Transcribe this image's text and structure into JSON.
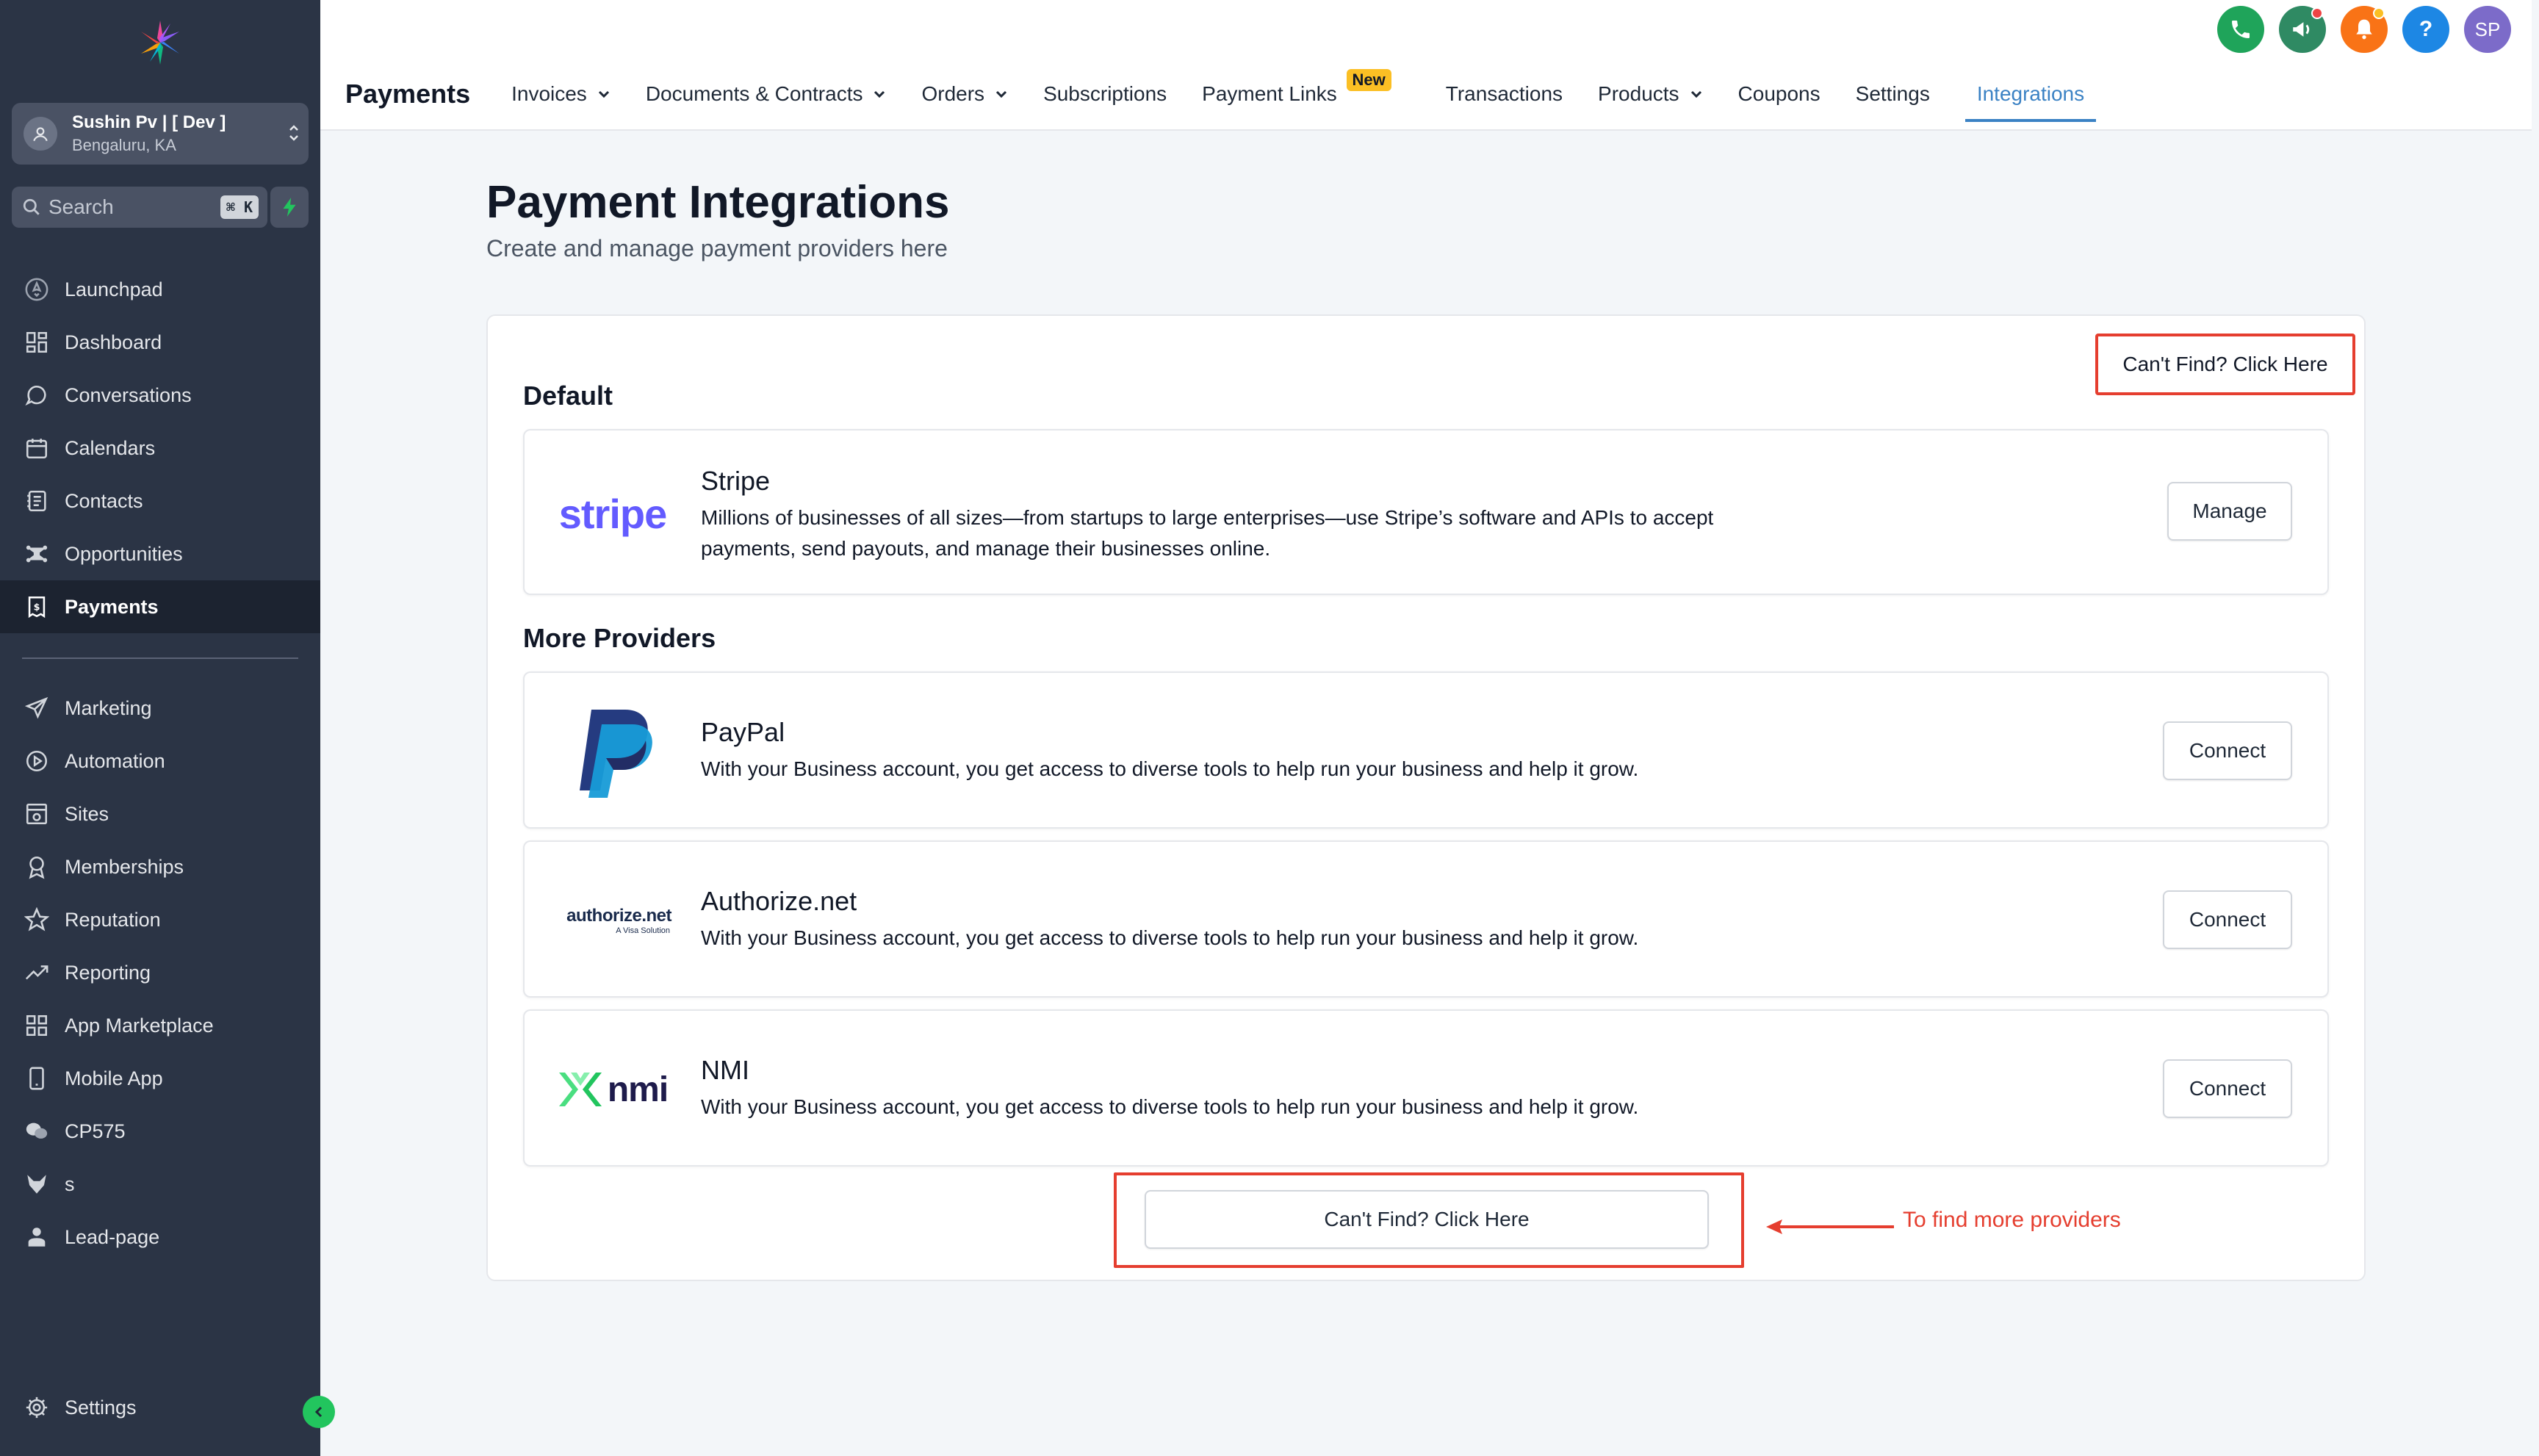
{
  "sidebar": {
    "account": {
      "name": "Sushin Pv | [ Dev ]",
      "location": "Bengaluru, KA"
    },
    "search": {
      "placeholder": "Search",
      "shortcut": "⌘ K"
    },
    "items": [
      {
        "label": "Launchpad",
        "icon": "rocket-icon"
      },
      {
        "label": "Dashboard",
        "icon": "dashboard-icon"
      },
      {
        "label": "Conversations",
        "icon": "chat-icon"
      },
      {
        "label": "Calendars",
        "icon": "calendar-icon"
      },
      {
        "label": "Contacts",
        "icon": "contacts-icon"
      },
      {
        "label": "Opportunities",
        "icon": "opportunities-icon"
      },
      {
        "label": "Payments",
        "icon": "payments-icon",
        "active": true
      }
    ],
    "items2": [
      {
        "label": "Marketing",
        "icon": "send-icon"
      },
      {
        "label": "Automation",
        "icon": "automation-icon"
      },
      {
        "label": "Sites",
        "icon": "sites-icon"
      },
      {
        "label": "Memberships",
        "icon": "membership-icon"
      },
      {
        "label": "Reputation",
        "icon": "star-icon"
      },
      {
        "label": "Reporting",
        "icon": "trend-icon"
      },
      {
        "label": "App Marketplace",
        "icon": "grid-icon"
      },
      {
        "label": "Mobile App",
        "icon": "mobile-icon"
      },
      {
        "label": "CP575",
        "icon": "chat-bubbles-icon"
      },
      {
        "label": "s",
        "icon": "fox-icon"
      },
      {
        "label": "Lead-page",
        "icon": "user-badge-icon"
      }
    ],
    "settings_label": "Settings"
  },
  "topbar": {
    "title": "Payments",
    "tabs": [
      {
        "label": "Invoices",
        "caret": true
      },
      {
        "label": "Documents & Contracts",
        "caret": true
      },
      {
        "label": "Orders",
        "caret": true
      },
      {
        "label": "Subscriptions",
        "caret": false
      },
      {
        "label": "Payment Links",
        "caret": false,
        "badge": "New"
      },
      {
        "label": "Transactions",
        "caret": false
      },
      {
        "label": "Products",
        "caret": true
      },
      {
        "label": "Coupons",
        "caret": false
      },
      {
        "label": "Settings",
        "caret": false
      },
      {
        "label": "Integrations",
        "caret": false,
        "active": true
      }
    ],
    "avatar_initials": "SP",
    "help_label": "?",
    "colors": {
      "phone": "#1fa45a",
      "megaphone": "#2f8a63",
      "bell": "#f97316",
      "help": "#1d87e4",
      "avatar": "#7c6bc9"
    }
  },
  "main": {
    "title": "Payment Integrations",
    "subtitle": "Create and manage payment providers here",
    "cant_find_top": "Can't Find? Click Here",
    "default_section": "Default",
    "more_section": "More Providers",
    "providers": [
      {
        "name": "Stripe",
        "logo_text": "stripe",
        "description": "Millions of businesses of all sizes—from startups to large enterprises—use Stripe’s software and APIs to accept payments, send payouts, and manage their businesses online.",
        "button": "Manage"
      },
      {
        "name": "PayPal",
        "logo_text": "",
        "description": "With your Business account, you get access to diverse tools to help run your business and help it grow.",
        "button": "Connect"
      },
      {
        "name": "Authorize.net",
        "logo_text": "authorize.net",
        "logo_subtext": "A Visa Solution",
        "description": "With your Business account, you get access to diverse tools to help run your business and help it grow.",
        "button": "Connect"
      },
      {
        "name": "NMI",
        "logo_text": "nmi",
        "description": "With your Business account, you get access to diverse tools to help run your business and help it grow.",
        "button": "Connect"
      }
    ],
    "cant_find_bottom": "Can't Find? Click Here",
    "annotation": "To find more providers",
    "annotation_color": "#e53e2f"
  }
}
